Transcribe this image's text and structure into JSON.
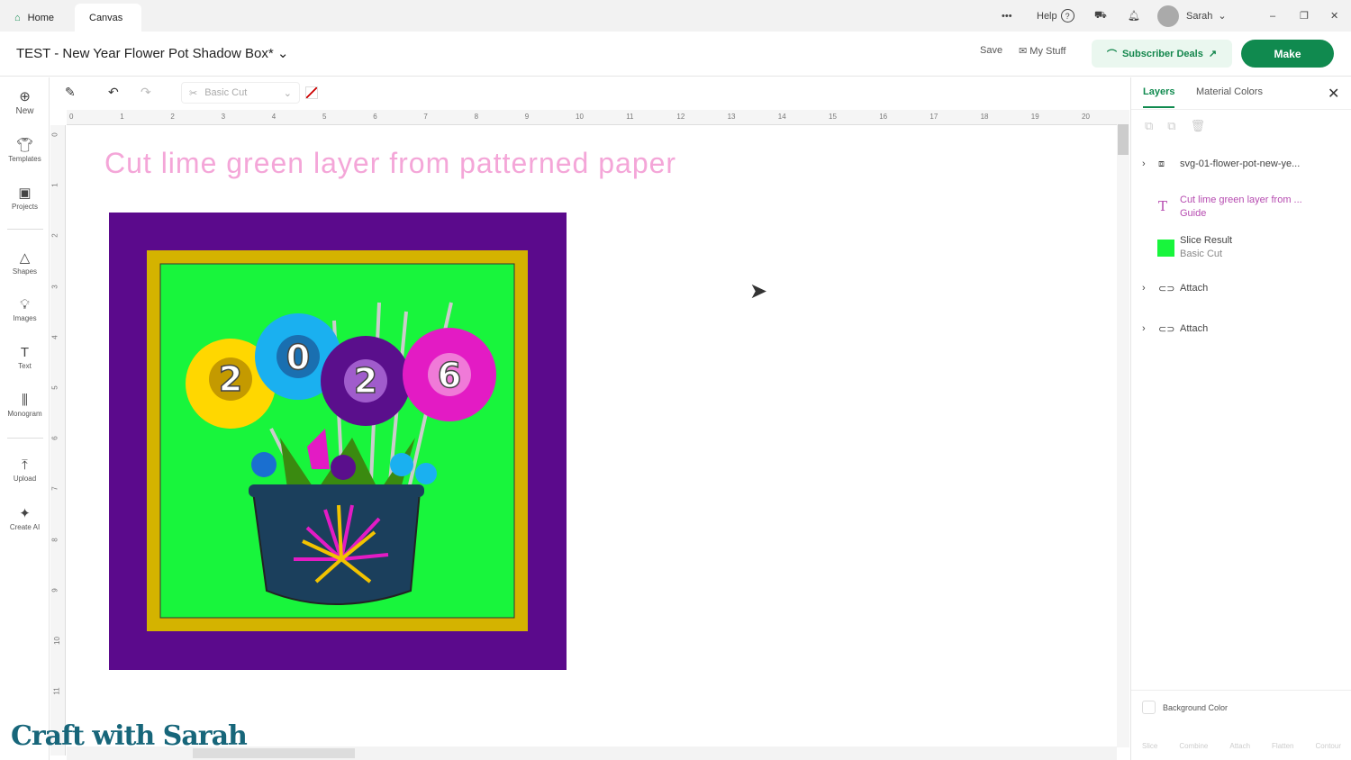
{
  "tabs": [
    {
      "label": "Home"
    },
    {
      "label": "Canvas"
    }
  ],
  "topbar": {
    "help": "Help",
    "user": "Sarah"
  },
  "header": {
    "title": "TEST - New Year Flower Pot Shadow Box*",
    "save": "Save",
    "my_stuff": "My Stuff",
    "deals": "Subscriber Deals",
    "make": "Make"
  },
  "leftbar": [
    {
      "label": "New",
      "icon": "plus-circle"
    },
    {
      "label": "Templates",
      "icon": "shirt"
    },
    {
      "label": "Projects",
      "icon": "projects"
    },
    {
      "label": "Shapes",
      "icon": "shapes"
    },
    {
      "label": "Images",
      "icon": "bulb"
    },
    {
      "label": "Text",
      "icon": "text"
    },
    {
      "label": "Monogram",
      "icon": "monogram"
    },
    {
      "label": "Upload",
      "icon": "upload"
    },
    {
      "label": "Create AI",
      "icon": "sparkle"
    }
  ],
  "toolbar": {
    "operation": "Basic Cut"
  },
  "ruler": {
    "h": [
      "0",
      "1",
      "2",
      "3",
      "4",
      "5",
      "6",
      "7",
      "8",
      "9",
      "10",
      "11",
      "12",
      "13",
      "14",
      "15",
      "16",
      "17",
      "18",
      "19",
      "20"
    ],
    "v": [
      "0",
      "1",
      "2",
      "3",
      "4",
      "5",
      "6",
      "7",
      "8",
      "9",
      "10",
      "11"
    ]
  },
  "canvas": {
    "guide_text": "Cut lime green layer from patterned paper",
    "numbers": [
      "2",
      "0",
      "2",
      "6"
    ],
    "colors": {
      "frame": "#5b0a8c",
      "gold": "#d4b300",
      "lime": "#18f53c"
    }
  },
  "panel": {
    "tabs": [
      "Layers",
      "Material Colors"
    ],
    "layers": [
      {
        "name": "svg-01-flower-pot-new-ye...",
        "sub": ""
      },
      {
        "name": "Cut lime green layer from ...",
        "sub": "Guide"
      },
      {
        "name": "Slice Result",
        "sub": "Basic Cut"
      },
      {
        "name": "Attach",
        "sub": ""
      },
      {
        "name": "Attach",
        "sub": ""
      }
    ],
    "background": "Background Color",
    "actions": [
      "Slice",
      "Combine",
      "Attach",
      "Flatten",
      "Contour"
    ]
  },
  "watermark": "Craft with Sarah"
}
